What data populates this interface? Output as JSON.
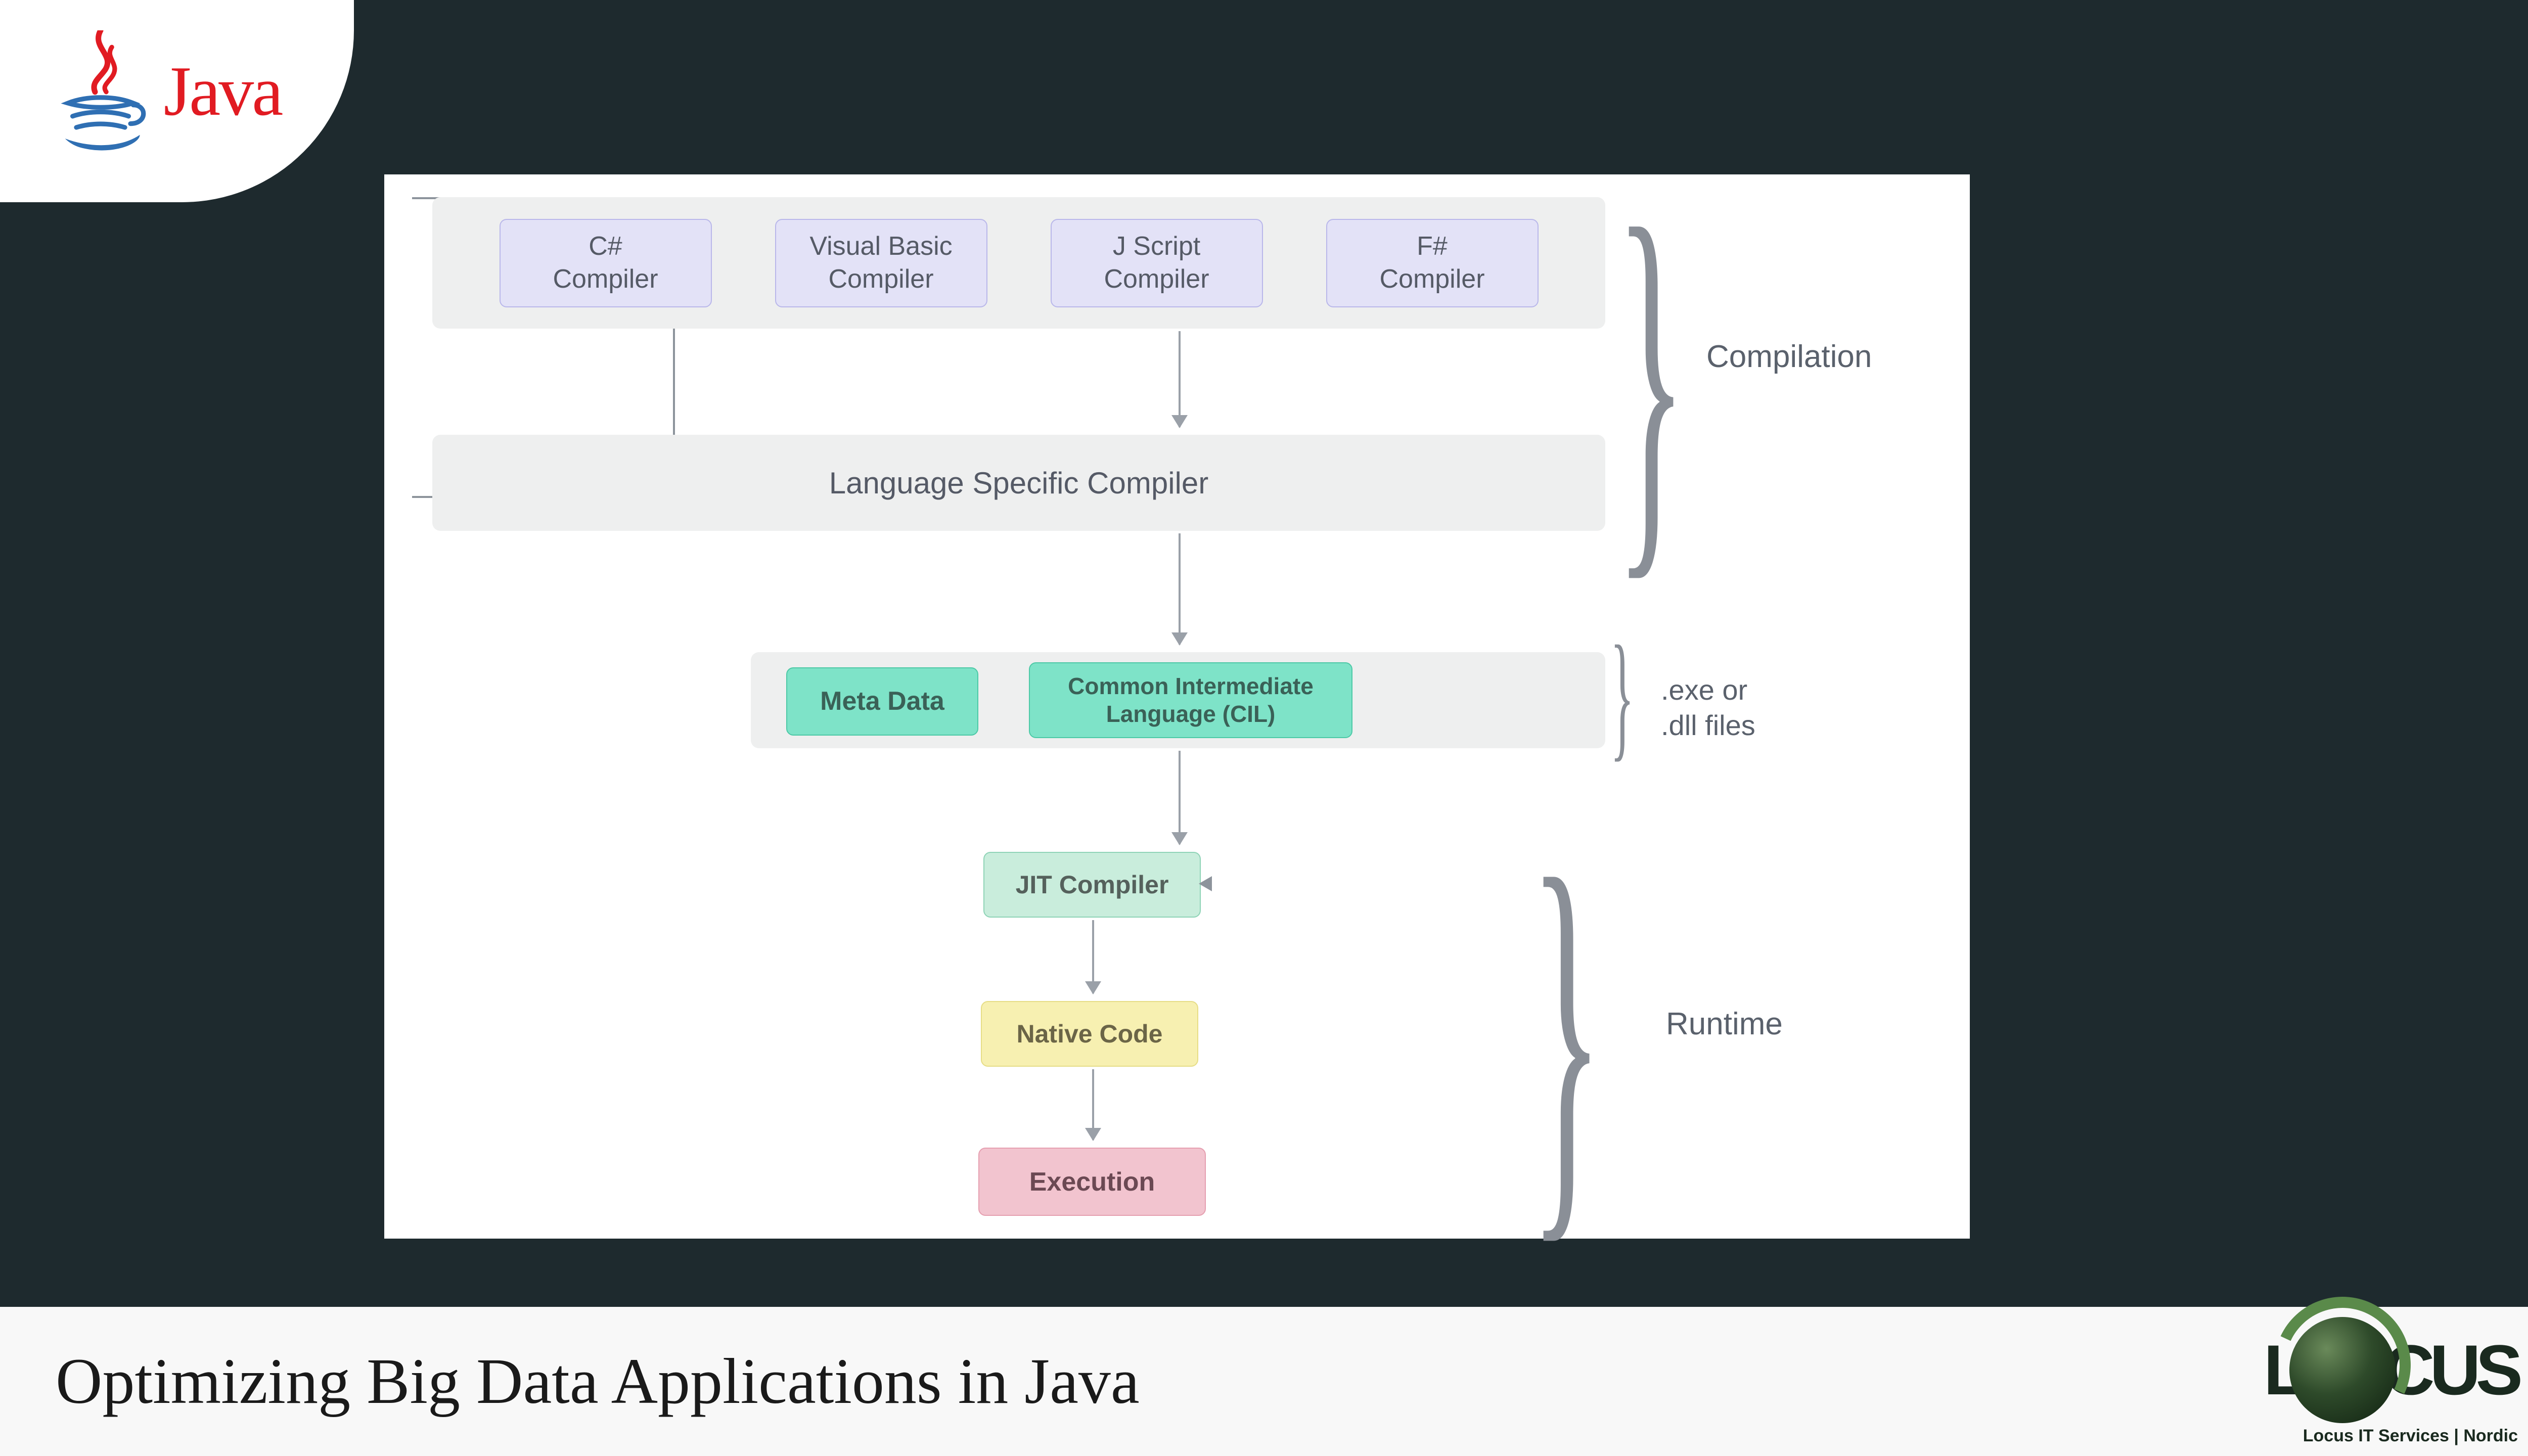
{
  "badge": {
    "brand": "Java"
  },
  "diagram": {
    "compilers": [
      "C#\nCompiler",
      "Visual Basic\nCompiler",
      "J Script\nCompiler",
      "F#\nCompiler"
    ],
    "lang_specific": "Language Specific Compiler",
    "meta": "Meta Data",
    "cil": "Common Intermediate\nLanguage (CIL)",
    "jit": "JIT Compiler",
    "native": "Native Code",
    "execution": "Execution",
    "annot_compilation": "Compilation",
    "annot_files": ".exe or\n.dll files",
    "annot_runtime": "Runtime"
  },
  "footer": {
    "title": "Optimizing Big Data Applications in Java",
    "logo_prefix": "L",
    "logo_suffix": "CUS",
    "logo_sub": "Locus IT Services | Nordic"
  }
}
